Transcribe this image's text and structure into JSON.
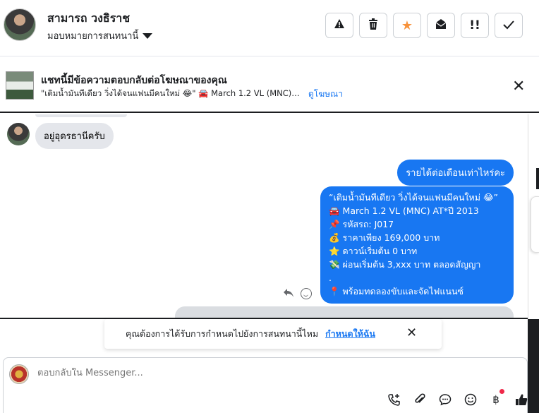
{
  "header": {
    "contact_name": "สามารถ วงธิราช",
    "assign_label": "มอบหมายการสนทนานี้",
    "buttons": [
      {
        "name": "report-button",
        "glyph": "▲!"
      },
      {
        "name": "delete-button",
        "glyph": "🗑"
      },
      {
        "name": "star-button",
        "glyph": "★"
      },
      {
        "name": "mark-unread-button",
        "glyph": "✉"
      },
      {
        "name": "priority-button",
        "glyph": "!!"
      },
      {
        "name": "done-button",
        "glyph": "✓"
      }
    ]
  },
  "ad_banner": {
    "title": "แชทนี้มีข้อความตอบกลับต่อโฆษณาของคุณ",
    "subtitle": "\"เติมน้ำมันทีเดียว วิ่งได้จนแฟนมีคนใหม่ 😂\" 🚘 March 1.2 VL (MNC) A...",
    "link": "ดูโฆษณา",
    "close_glyph": "✕"
  },
  "messages": {
    "incoming_1": "อยู่อุดรธานีครับ",
    "outgoing_1": "รายได้ต่อเดือนเท่าไหร่คะ",
    "outgoing_2_lines": [
      "“เติมน้ำมันทีเดียว วิ่งได้จนแฟนมีคนใหม่ 😂”",
      "🚘 March 1.2 VL (MNC) AT*ปี 2013",
      "📌 รหัสรถ: J017",
      "💰 ราคาเพียง 169,000 บาท",
      "⭐ ดาวน์เริ่มต้น 0 บาท",
      "💸 ผ่อนเริ่มต้น 3,xxx บาท ตลอดสัญญา",
      ".",
      "📍 พร้อมทดลองขับและจัดไฟแนนซ์"
    ]
  },
  "notice": {
    "text": "คุณต้องการได้รับการกำหนดไปยังการสนทนานี้ไหม",
    "link": "กำหนดให้ฉัน",
    "close_glyph": "✕"
  },
  "composer": {
    "placeholder": "ตอบกลับใน Messenger...",
    "tools": [
      {
        "name": "call-add-icon",
        "glyph": "☏"
      },
      {
        "name": "attach-icon",
        "glyph": "📎"
      },
      {
        "name": "saved-reply-icon",
        "glyph": "💬"
      },
      {
        "name": "emoji-icon",
        "glyph": "☺"
      },
      {
        "name": "payment-icon",
        "glyph": "฿"
      },
      {
        "name": "like-icon",
        "glyph": "👍"
      }
    ]
  },
  "colors": {
    "accent": "#1877f2",
    "bubble_in": "#e4e6eb",
    "star": "#f7923b"
  }
}
